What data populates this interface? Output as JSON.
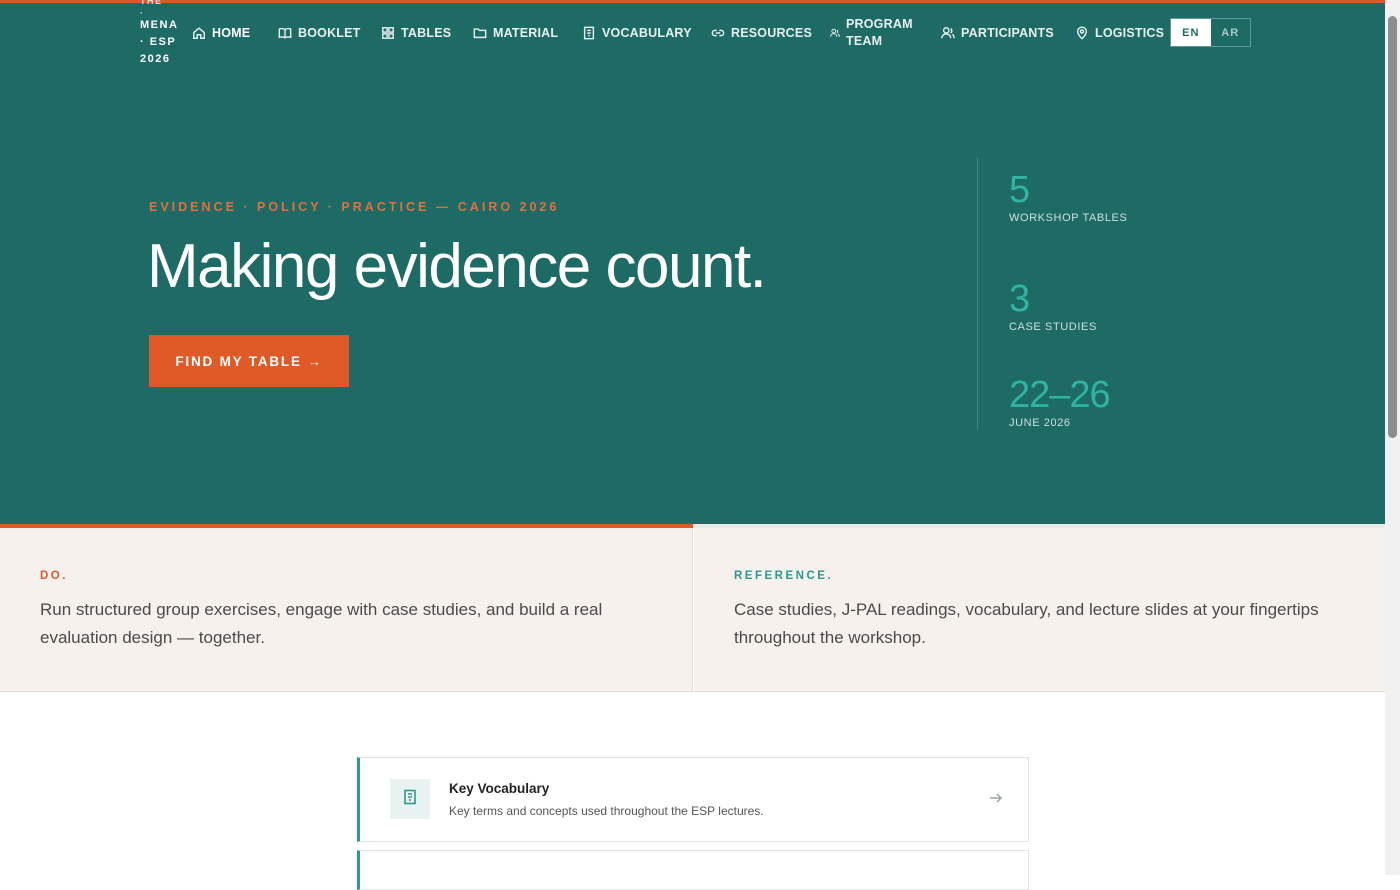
{
  "brand": {
    "lines": [
      "THE",
      "·",
      "MENA",
      "· ESP",
      "2026"
    ]
  },
  "nav": {
    "items": [
      {
        "label": "HOME",
        "icon": "home-icon"
      },
      {
        "label": "BOOKLET",
        "icon": "book-icon"
      },
      {
        "label": "TABLES",
        "icon": "grid-icon"
      },
      {
        "label": "MATERIAL",
        "icon": "folder-icon"
      },
      {
        "label": "VOCABULARY",
        "icon": "dictionary-icon"
      },
      {
        "label": "RESOURCES",
        "icon": "link-icon"
      },
      {
        "label": "PROGRAM",
        "label2": "TEAM",
        "icon": "team-icon"
      },
      {
        "label": "PARTICIPANTS",
        "icon": "users-icon"
      },
      {
        "label": "LOGISTICS",
        "icon": "map-pin-icon"
      }
    ],
    "lang": {
      "active": "EN",
      "other": "AR"
    }
  },
  "hero": {
    "eyebrow": "EVIDENCE · POLICY · PRACTICE — CAIRO 2026",
    "headline": "Making evidence count.",
    "cta": "FIND MY TABLE →",
    "stats": [
      {
        "value": "5",
        "label": "WORKSHOP TABLES"
      },
      {
        "value": "3",
        "label": "CASE STUDIES"
      },
      {
        "value": "22–26",
        "label": "JUNE 2026"
      }
    ]
  },
  "strip": {
    "left": {
      "kicker": "DO.",
      "body": "Run structured group exercises, engage with case studies, and build a real evaluation design — together."
    },
    "right": {
      "kicker": "REFERENCE.",
      "body": "Case studies, J-PAL readings, vocabulary, and lecture slides at your fingertips throughout the workshop."
    }
  },
  "cards": [
    {
      "title": "Key Vocabulary",
      "desc": "Key terms and concepts used throughout the ESP lectures.",
      "icon": "dictionary-icon"
    }
  ],
  "colors": {
    "hero_bg": "#1e6b66",
    "accent_orange": "#e05a27",
    "accent_teal": "#2a9a8d",
    "strip_bg": "#f6f1ed"
  }
}
